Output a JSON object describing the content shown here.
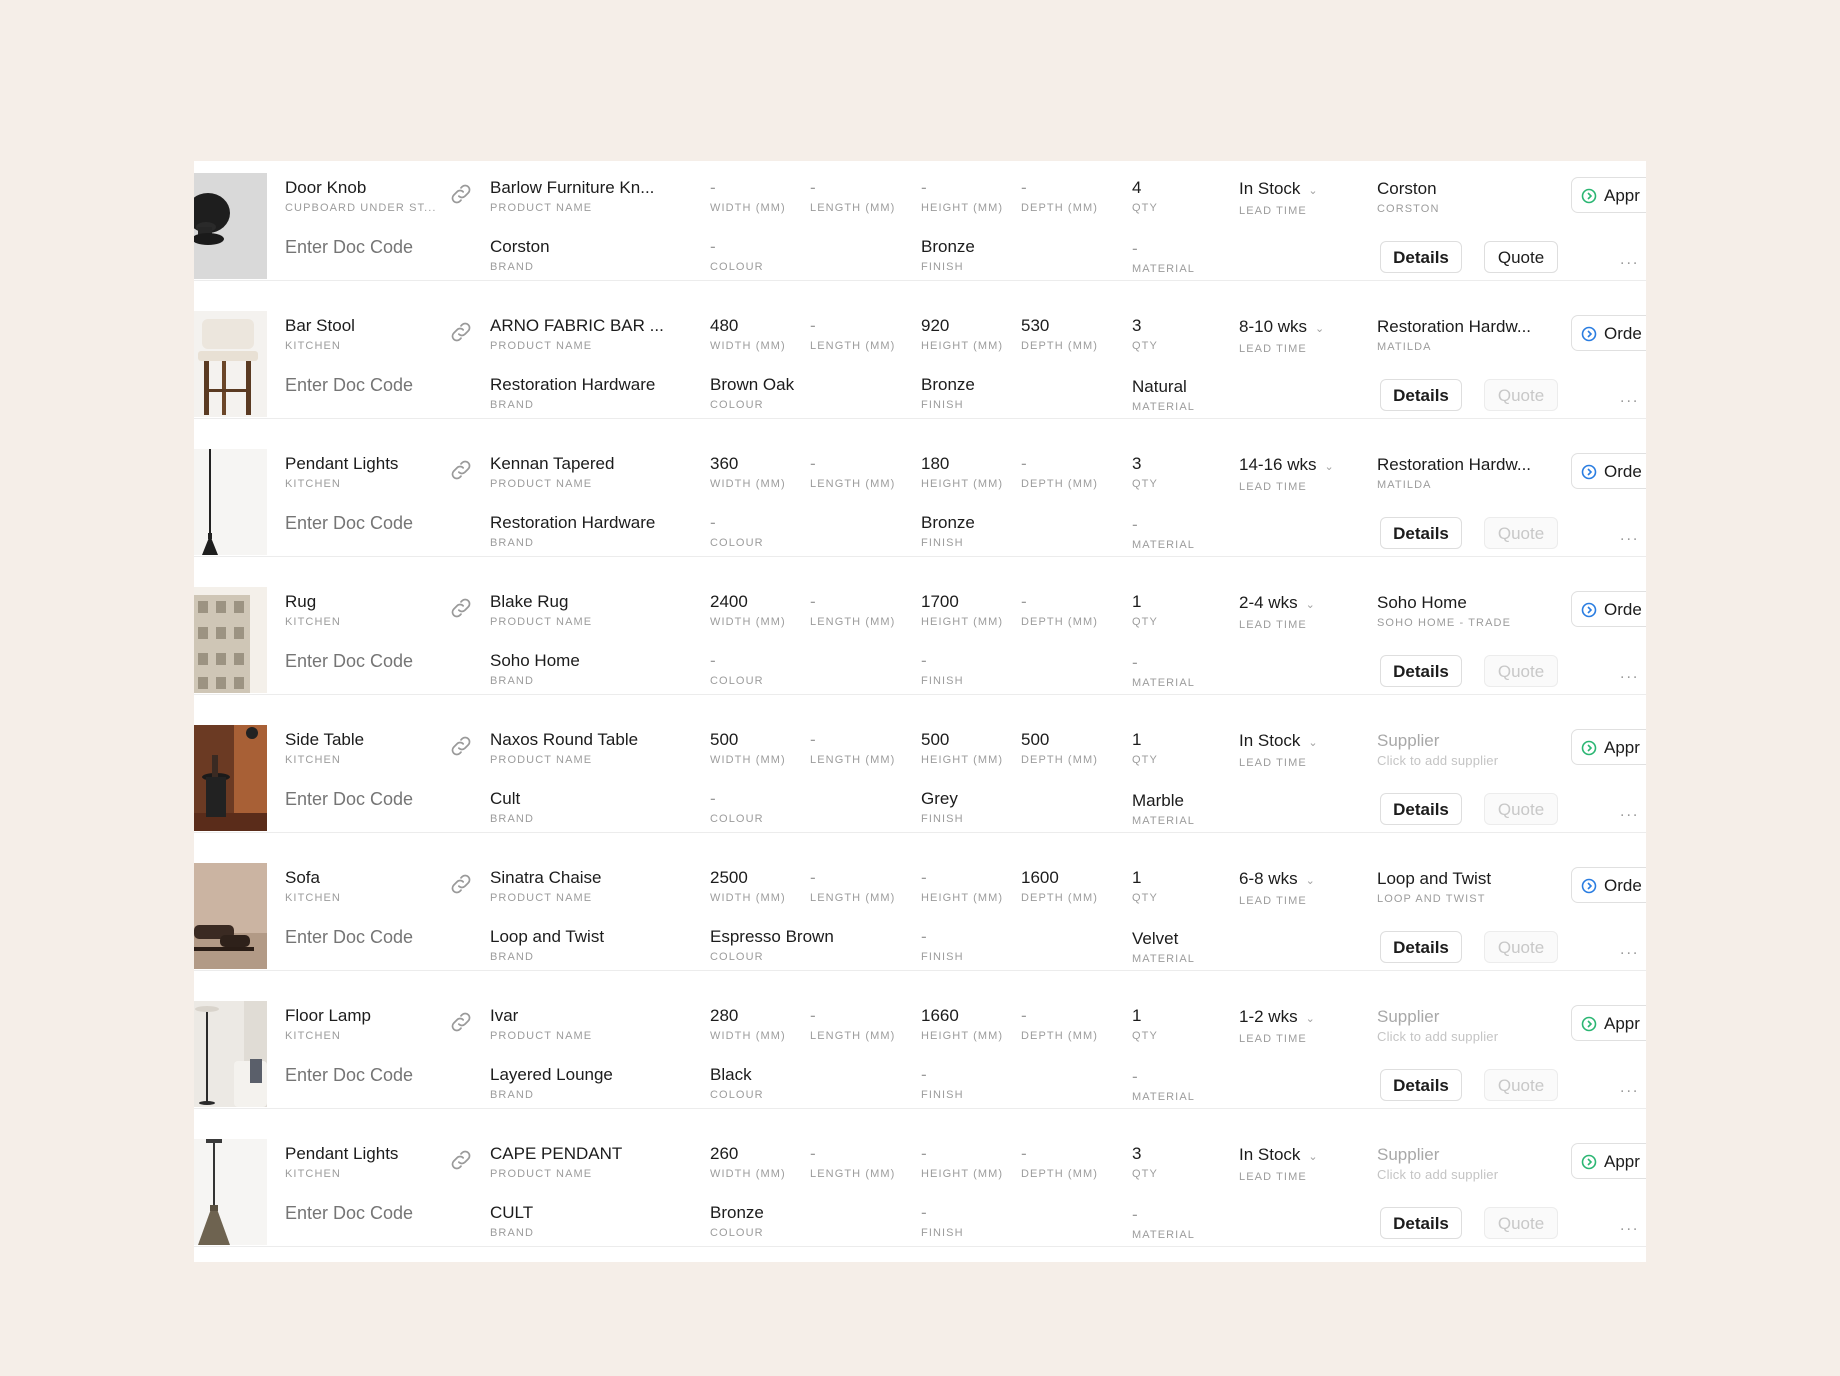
{
  "colors": {
    "background": "#f5eee8",
    "status_icon": "#1aa36b",
    "approved_icon": "#2bb673",
    "ordered_icon": "#2a7de1"
  },
  "labels": {
    "product_name": "PRODUCT NAME",
    "brand": "BRAND",
    "width": "WIDTH (MM)",
    "length": "LENGTH (MM)",
    "height": "HEIGHT (MM)",
    "depth": "DEPTH (MM)",
    "colour": "COLOUR",
    "finish": "FINISH",
    "qty": "QTY",
    "material": "MATERIAL",
    "lead_time": "LEAD TIME",
    "details": "Details",
    "quote": "Quote",
    "more": "..."
  },
  "rows": [
    {
      "name": "Door Knob",
      "room": "CUPBOARD UNDER ST...",
      "doc_placeholder": "Enter Doc Code",
      "product": "Barlow Furniture Kn...",
      "brand": "Corston",
      "width": "-",
      "length": "-",
      "height": "-",
      "depth": "-",
      "colour": "-",
      "finish": "Bronze",
      "qty": "4",
      "material": "-",
      "lead": "In Stock",
      "supplier": "Corston",
      "supplier_sub": "CORSTON",
      "status": "Appr",
      "status_kind": "approved",
      "quote_enabled": true,
      "thumb": "knob-icon"
    },
    {
      "name": "Bar Stool",
      "room": "KITCHEN",
      "doc_placeholder": "Enter Doc Code",
      "product": "ARNO FABRIC BAR ...",
      "brand": "Restoration Hardware",
      "width": "480",
      "length": "-",
      "height": "920",
      "depth": "530",
      "colour": "Brown Oak",
      "finish": "Bronze",
      "qty": "3",
      "material": "Natural",
      "lead": "8-10 wks",
      "supplier": "Restoration Hardw...",
      "supplier_sub": "MATILDA",
      "status": "Orde",
      "status_kind": "ordered",
      "quote_enabled": false,
      "thumb": "stool-icon"
    },
    {
      "name": "Pendant Lights",
      "room": "KITCHEN",
      "doc_placeholder": "Enter Doc Code",
      "product": "Kennan Tapered",
      "brand": "Restoration Hardware",
      "width": "360",
      "length": "-",
      "height": "180",
      "depth": "-",
      "colour": "-",
      "finish": "Bronze",
      "qty": "3",
      "material": "-",
      "lead": "14-16 wks",
      "supplier": "Restoration Hardw...",
      "supplier_sub": "MATILDA",
      "status": "Orde",
      "status_kind": "ordered",
      "quote_enabled": false,
      "thumb": "pendant-thin-icon"
    },
    {
      "name": "Rug",
      "room": "KITCHEN",
      "doc_placeholder": "Enter Doc Code",
      "product": "Blake Rug",
      "brand": "Soho Home",
      "width": "2400",
      "length": "-",
      "height": "1700",
      "depth": "-",
      "colour": "-",
      "finish": "-",
      "qty": "1",
      "material": "-",
      "lead": "2-4 wks",
      "supplier": "Soho Home",
      "supplier_sub": "SOHO HOME - TRADE",
      "status": "Orde",
      "status_kind": "ordered",
      "quote_enabled": false,
      "thumb": "rug-icon"
    },
    {
      "name": "Side Table",
      "room": "KITCHEN",
      "doc_placeholder": "Enter Doc Code",
      "product": "Naxos Round Table",
      "brand": "Cult",
      "width": "500",
      "length": "-",
      "height": "500",
      "depth": "500",
      "colour": "-",
      "finish": "Grey",
      "qty": "1",
      "material": "Marble",
      "lead": "In Stock",
      "supplier": "Supplier",
      "supplier_sub": "Click to add supplier",
      "supplier_placeholder": true,
      "status": "Appr",
      "status_kind": "approved",
      "quote_enabled": false,
      "thumb": "side-table-icon"
    },
    {
      "name": "Sofa",
      "room": "KITCHEN",
      "doc_placeholder": "Enter Doc Code",
      "product": "Sinatra Chaise",
      "brand": "Loop and Twist",
      "width": "2500",
      "length": "-",
      "height": "-",
      "depth": "1600",
      "colour": "Espresso Brown",
      "finish": "-",
      "qty": "1",
      "material": "Velvet",
      "lead": "6-8 wks",
      "supplier": "Loop and Twist",
      "supplier_sub": "LOOP AND TWIST",
      "status": "Orde",
      "status_kind": "ordered",
      "quote_enabled": false,
      "thumb": "sofa-icon"
    },
    {
      "name": "Floor Lamp",
      "room": "KITCHEN",
      "doc_placeholder": "Enter Doc Code",
      "product": "Ivar",
      "brand": "Layered Lounge",
      "width": "280",
      "length": "-",
      "height": "1660",
      "depth": "-",
      "colour": "Black",
      "finish": "-",
      "qty": "1",
      "material": "-",
      "lead": "1-2 wks",
      "supplier": "Supplier",
      "supplier_sub": "Click to add supplier",
      "supplier_placeholder": true,
      "status": "Appr",
      "status_kind": "approved",
      "quote_enabled": false,
      "thumb": "floor-lamp-icon"
    },
    {
      "name": "Pendant Lights",
      "room": "KITCHEN",
      "doc_placeholder": "Enter Doc Code",
      "product": "CAPE PENDANT",
      "brand": "CULT",
      "width": "260",
      "length": "-",
      "height": "-",
      "depth": "-",
      "colour": "Bronze",
      "finish": "-",
      "qty": "3",
      "material": "-",
      "lead": "In Stock",
      "supplier": "Supplier",
      "supplier_sub": "Click to add supplier",
      "supplier_placeholder": true,
      "status": "Appr",
      "status_kind": "approved",
      "quote_enabled": false,
      "thumb": "pendant-cone-icon"
    }
  ]
}
